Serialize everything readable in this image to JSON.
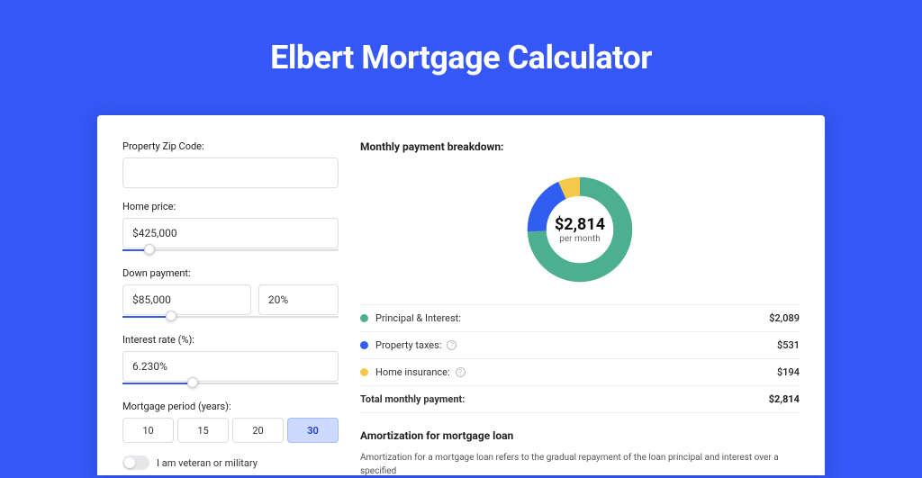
{
  "header": {
    "title": "Elbert Mortgage Calculator"
  },
  "form": {
    "zip": {
      "label": "Property Zip Code:",
      "value": ""
    },
    "home_price": {
      "label": "Home price:",
      "value": "$425,000",
      "slider_pct": 10
    },
    "down_payment": {
      "label": "Down payment:",
      "amount": "$85,000",
      "percent": "20%",
      "slider_pct": 20
    },
    "interest": {
      "label": "Interest rate (%):",
      "value": "6.230%",
      "slider_pct": 30
    },
    "period": {
      "label": "Mortgage period (years):",
      "options": [
        "10",
        "15",
        "20",
        "30"
      ],
      "selected": "30"
    },
    "veteran": {
      "label": "I am veteran or military",
      "on": false
    }
  },
  "breakdown": {
    "title": "Monthly payment breakdown:",
    "center_amount": "$2,814",
    "center_sub": "per month",
    "items": [
      {
        "name": "Principal & Interest:",
        "value": "$2,089",
        "color": "#4caf8f",
        "info": false
      },
      {
        "name": "Property taxes:",
        "value": "$531",
        "color": "#2f5ef0",
        "info": true
      },
      {
        "name": "Home insurance:",
        "value": "$194",
        "color": "#f4c94b",
        "info": true
      }
    ],
    "total": {
      "name": "Total monthly payment:",
      "value": "$2,814"
    }
  },
  "amort": {
    "title": "Amortization for mortgage loan",
    "text": "Amortization for a mortgage loan refers to the gradual repayment of the loan principal and interest over a specified"
  },
  "chart_data": {
    "type": "pie",
    "title": "Monthly payment breakdown",
    "series": [
      {
        "name": "Principal & Interest",
        "value": 2089,
        "color": "#4caf8f"
      },
      {
        "name": "Property taxes",
        "value": 531,
        "color": "#2f5ef0"
      },
      {
        "name": "Home insurance",
        "value": 194,
        "color": "#f4c94b"
      }
    ],
    "total": 2814,
    "center_label": "$2,814 per month"
  }
}
